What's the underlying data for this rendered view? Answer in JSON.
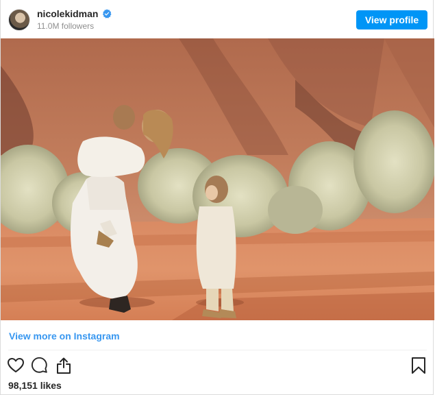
{
  "header": {
    "username": "nicolekidman",
    "verified_badge": "verified-badge-icon",
    "followers": "11.0M followers",
    "view_profile_label": "View profile"
  },
  "photo": {
    "alt": "Photo of a woman carrying a child piggyback in a white dress, with another child standing nearby, in a red desert landscape with a large rock formation behind"
  },
  "footer": {
    "view_more_label": "View more on Instagram",
    "likes": "98,151 likes"
  },
  "icons": {
    "like": "heart-icon",
    "comment": "comment-icon",
    "share": "share-icon",
    "save": "bookmark-icon"
  },
  "colors": {
    "accent_button": "#0095f6",
    "link": "#3897f0",
    "text": "#262626",
    "muted": "#8e8e8e"
  }
}
